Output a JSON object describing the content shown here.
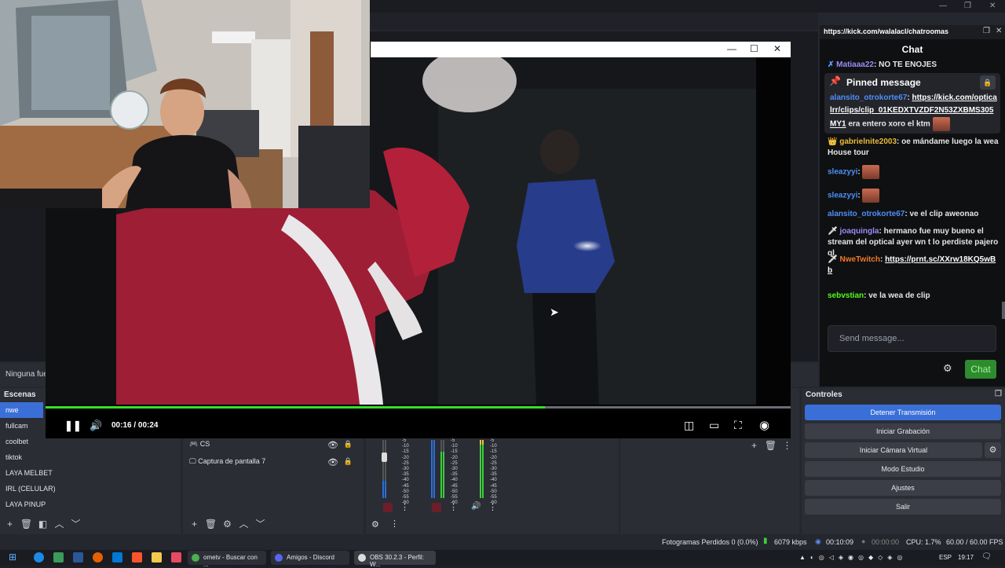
{
  "obs": {
    "preview_source_label": "Ninguna fue",
    "scenes_title": "Escenas",
    "scenes": [
      "nwe",
      "fullcam",
      "coolbet",
      "tiktok",
      "LAYA MELBET",
      "IRL (CELULAR)",
      "LAYA PINUP"
    ],
    "active_scene_index": 0,
    "sources": [
      {
        "label": "CS"
      },
      {
        "label": "Captura de pantalla 7"
      }
    ],
    "meter_scale": [
      "-5",
      "-10",
      "-15",
      "-20",
      "-25",
      "-30",
      "-35",
      "-40",
      "-45",
      "-50",
      "-55",
      "-60"
    ],
    "controls_title": "Controles",
    "controls": {
      "stop_stream": "Detener Transmisión",
      "start_recording": "Iniciar Grabación",
      "start_virtual_cam": "Iniciar Cámara Virtual",
      "studio_mode": "Modo Estudio",
      "settings": "Ajustes",
      "exit": "Salir"
    },
    "status": {
      "dropped_frames": "Fotogramas Perdidos 0 (0.0%)",
      "bitrate": "6079 kbps",
      "stream_time": "00:10:09",
      "record_time": "00:00:00",
      "cpu": "CPU: 1.7%",
      "fps": "60.00 / 60.00 FPS"
    },
    "accent": "#3a6fd8"
  },
  "chat": {
    "url": "https://kick.com/walalacl/chatroomas",
    "title": "Chat",
    "top_partial": {
      "user": "Matiaaa22",
      "text": "NO TE ENOJES"
    },
    "pinned": {
      "label": "Pinned message",
      "user": "alansito_otrokorte67",
      "link": "https://kick.com/opticalrr/clips/clip_01KEDXTVZDF2N53ZXBMS305MY1",
      "text": "era entero xoro el ktm"
    },
    "messages": [
      {
        "user": "gabrielnite2003",
        "text": "oe mándame luego la wea House tour",
        "color": "#e9b93a",
        "badge": "👑"
      },
      {
        "user": "sleazyyi",
        "text": "",
        "color": "#4f8ef7",
        "badge": "",
        "emote": true
      },
      {
        "user": "sleazyyi",
        "text": "",
        "color": "#4f8ef7",
        "badge": "",
        "emote": true
      },
      {
        "user": "alansito_otrokorte67",
        "text": "ve el clip aweonao",
        "color": "#4f8ef7",
        "badge": ""
      },
      {
        "user": "joaquingla",
        "text": "hermano fue muy bueno el stream del optical ayer wn t lo perdiste pajero ql",
        "color": "#9b8cf5",
        "badge": "🗡"
      },
      {
        "user": "NweTwitch",
        "text": "https://prnt.sc/XXrw18KQ5wBb",
        "color": "#f07a2a",
        "badge": "🗡"
      },
      {
        "user": "sebvstian",
        "text": "ve la wea de clip",
        "color": "#53fc18",
        "badge": ""
      }
    ],
    "input_placeholder": "Send message...",
    "send_label": "Chat",
    "brand_green": "#53fc18"
  },
  "player": {
    "current_time": "00:16",
    "separator": " / ",
    "duration": "00:24",
    "progress": 0.67
  },
  "taskbar": {
    "apps": [
      {
        "label": "ometv - Buscar con ...",
        "color": "#4caf50"
      },
      {
        "label": "Amigos - Discord",
        "color": "#5865f2"
      },
      {
        "label": "OBS 30.2.3 - Perfil: W...",
        "color": "#ddd"
      }
    ],
    "language": "ESP",
    "clock": "19:17"
  }
}
